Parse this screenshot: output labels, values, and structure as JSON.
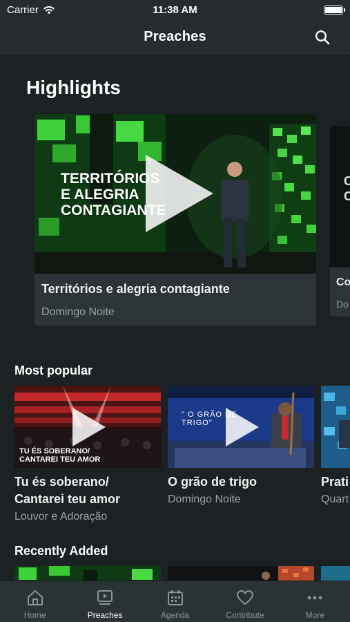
{
  "status_bar": {
    "carrier": "Carrier",
    "time": "11:38 AM"
  },
  "nav": {
    "title": "Preaches",
    "search_icon": "search-icon"
  },
  "highlights": {
    "title": "Highlights",
    "cards": [
      {
        "overlay_text_lines": [
          "TERRITÓRIOS",
          "E ALEGRIA",
          "CONTAGIANTE"
        ],
        "title": "Territórios e alegria contagiante",
        "subtitle": "Domingo Noite"
      },
      {
        "overlay_text_lines": [
          "C",
          "C"
        ],
        "title": "Co",
        "subtitle": "Do"
      }
    ]
  },
  "most_popular": {
    "title": "Most popular",
    "items": [
      {
        "caption_lines": [
          "TU ÉS SOBERANO/",
          "CANTAREI TEU AMOR"
        ],
        "title_lines": [
          "Tu és soberano/",
          "Cantarei teu amor"
        ],
        "subtitle": "Louvor e Adoração"
      },
      {
        "caption_lines": [
          "\" O GRÃO DE",
          "TRIGO\""
        ],
        "title_lines": [
          "O grão de trigo"
        ],
        "subtitle": "Domingo Noite"
      },
      {
        "title_lines": [
          "Prati"
        ],
        "subtitle": "Quart"
      }
    ]
  },
  "recently_added": {
    "title": "Recently Added"
  },
  "tab_bar": {
    "tabs": [
      {
        "label": "Home",
        "icon": "home-icon"
      },
      {
        "label": "Preaches",
        "icon": "video-play-icon",
        "active": true
      },
      {
        "label": "Agenda",
        "icon": "calendar-icon"
      },
      {
        "label": "Contribute",
        "icon": "heart-icon"
      },
      {
        "label": "More",
        "icon": "more-icon"
      }
    ]
  },
  "colors": {
    "background": "#1c2124",
    "bar": "#252b2e",
    "card": "#2d3438",
    "tab_bar": "#2b3236",
    "accent_green": "#3fd13a",
    "muted_text": "#9aa3a7"
  }
}
